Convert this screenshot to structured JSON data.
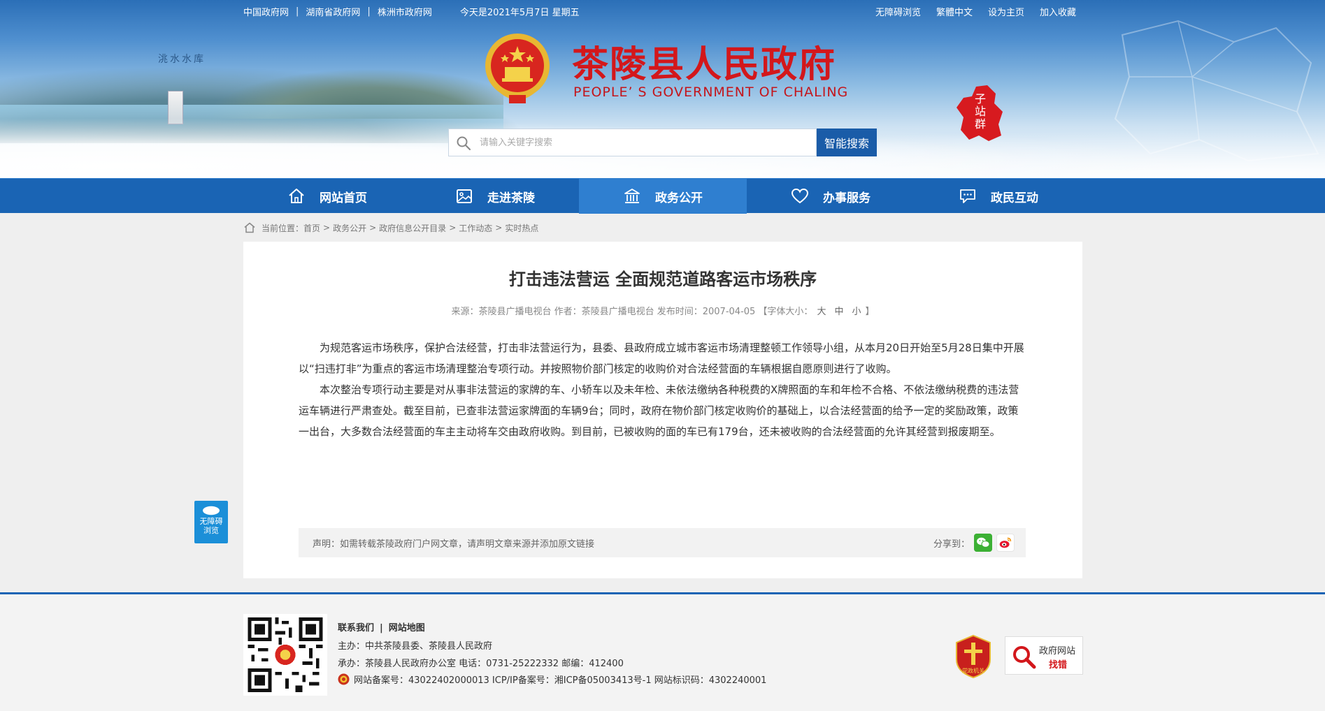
{
  "colors": {
    "nav_blue": "#1a64b4",
    "nav_active": "#2f7fd0",
    "title_red": "#d3171b",
    "search_button": "#1a5ca8",
    "access_widget": "#1b8fd8"
  },
  "topbar": {
    "links": [
      "中国政府网",
      "湖南省政府网",
      "株洲市政府网"
    ],
    "date": "今天是2021年5月7日 星期五",
    "right_links": [
      "无障碍浏览",
      "繁體中文",
      "设为主页",
      "加入收藏"
    ]
  },
  "header": {
    "reservoir_label": "洮水水库",
    "title": "茶陵县人民政府",
    "subtitle": "PEOPLE’ S GOVERNMENT OF CHALING",
    "substation": "子站群",
    "emblem_icon": "national-emblem-icon"
  },
  "search": {
    "placeholder": "请输入关键字搜索",
    "button": "智能搜索"
  },
  "nav": [
    {
      "label": "网站首页",
      "icon": "home-icon"
    },
    {
      "label": "走进茶陵",
      "icon": "picture-icon"
    },
    {
      "label": "政务公开",
      "icon": "government-building-icon",
      "active": true
    },
    {
      "label": "办事服务",
      "icon": "heart-icon"
    },
    {
      "label": "政民互动",
      "icon": "chat-icon"
    }
  ],
  "breadcrumb": {
    "prefix": "当前位置：",
    "items": [
      "首页",
      "政务公开",
      "政府信息公开目录",
      "工作动态",
      "实时热点"
    ]
  },
  "article": {
    "title": "打击违法营运 全面规范道路客运市场秩序",
    "meta": "来源：茶陵县广播电视台 作者：茶陵县广播电视台 发布时间：2007-04-05 【字体大小：",
    "font_sizes": [
      "大",
      "中",
      "小"
    ],
    "meta_end": "】",
    "paragraphs": [
      "为规范客运市场秩序，保护合法经营，打击非法营运行为，县委、县政府成立城市客运市场清理整顿工作领导小组，从本月20日开始至5月28日集中开展以“扫违打非”为重点的客运市场清理整治专项行动。并按照物价部门核定的收购价对合法经营面的车辆根据自愿原则进行了收购。",
      "本次整治专项行动主要是对从事非法营运的家牌的车、小轿车以及未年检、未依法缴纳各种税费的X牌照面的车和年检不合格、不依法缴纳税费的违法营运车辆进行严肃查处。截至目前，已查非法营运家牌面的车辆9台；同时，政府在物价部门核定收购价的基础上，以合法经营面的给予一定的奖励政策，政策一出台，大多数合法经营面的车主主动将车交由政府收购。到目前，已被收购的面的车已有179台，还未被收购的合法经营面的允许其经营到报废期至。"
    ],
    "notice": "声明：如需转载茶陵政府门户网文章，请声明文章来源并添加原文链接",
    "share_label": "分享到："
  },
  "side_widget": {
    "label_line1": "无障碍",
    "label_line2": "浏览"
  },
  "footer": {
    "links": [
      "联系我们",
      "网站地图"
    ],
    "sponsor": "主办：中共茶陵县委、茶陵县人民政府",
    "organizer": "承办：茶陵县人民政府办公室 电话：0731-25222332 邮编：412400",
    "record": "网站备案号：43022402000013 ICP/IP备案号：湘ICP备05003413号-1 网站标识码：4302240001",
    "party_badge_text": "党政机关",
    "error_finder_line1": "政府网站",
    "error_finder_line2": "找错"
  }
}
